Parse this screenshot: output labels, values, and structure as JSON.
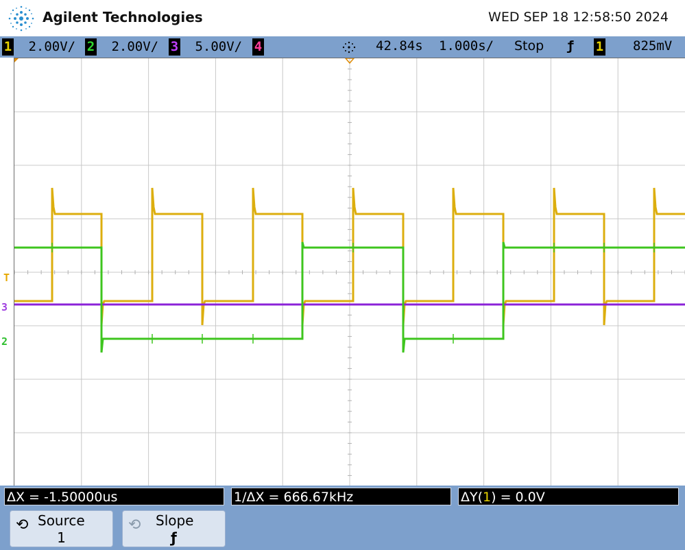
{
  "header": {
    "brand": "Agilent Technologies",
    "datetime": "WED SEP 18 12:58:50 2024"
  },
  "status_bar": {
    "channels": [
      {
        "num": "1",
        "scale": "2.00V/",
        "color": "#e6d100"
      },
      {
        "num": "2",
        "scale": "2.00V/",
        "color": "#2fd62f"
      },
      {
        "num": "3",
        "scale": "5.00V/",
        "color": "#c040ff"
      },
      {
        "num": "4",
        "scale": "",
        "color": "#ff3c9a"
      }
    ],
    "delay": "42.84s",
    "timebase": "1.000s/",
    "run_state": "Stop",
    "trigger_slope_icon": "rising-edge-icon",
    "trigger_source": "1",
    "trigger_level": "825mV"
  },
  "screen": {
    "trigger_marker": "T",
    "ch3_marker": "3",
    "ch2_marker": "2"
  },
  "trace_colors": {
    "ch1": "#dcae0e",
    "ch2": "#3ec51e",
    "ch3": "#8b22d8"
  },
  "measurements": {
    "delta_x": "ΔX = -1.50000us",
    "inv_delta_x": "1/ΔX = 666.67kHz",
    "delta_y_prefix": "ΔY(",
    "delta_y_ch": "1",
    "delta_y_suffix": ") = 0.0V"
  },
  "softkeys": [
    {
      "label": "Source",
      "value": "1"
    },
    {
      "label": "Slope",
      "value": "rising-edge"
    }
  ]
}
